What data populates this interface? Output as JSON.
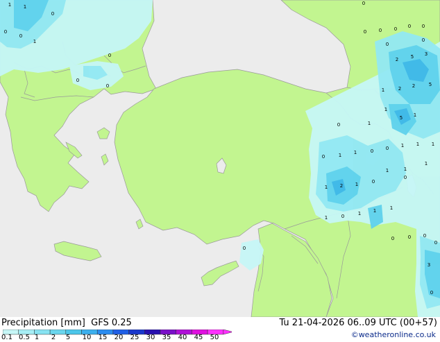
{
  "colors": {
    "sea": "#ececec",
    "land": "#c2f590",
    "border": "#999999",
    "p_light": "#c6f7f7",
    "p_mid": "#92e8f2",
    "p_strong": "#5fd2ec",
    "p_heavy": "#3fb8e8",
    "label": "#000000"
  },
  "legend": {
    "title": "Precipitation [mm]",
    "model": "GFS 0.25",
    "run_info": "Tu 21-04-2026 06..09 UTC (00+57)",
    "credit": "©weatheronline.co.uk",
    "scale_labels": [
      "0.1",
      "0.5",
      "1",
      "2",
      "5",
      "10",
      "15",
      "20",
      "25",
      "30",
      "35",
      "40",
      "45",
      "50"
    ],
    "scale_colors": [
      "#c6f7f7",
      "#a7eef5",
      "#88e3f2",
      "#6ad6ee",
      "#4cc6ea",
      "#3cb0ee",
      "#2b8cf0",
      "#1f5fe6",
      "#1a38cc",
      "#2810b0",
      "#7a10c8",
      "#b010d8",
      "#e010e0",
      "#ff30ff"
    ]
  },
  "map_labels": [
    "1",
    "1",
    "0",
    "0",
    "0",
    "1",
    "0",
    "0",
    "0",
    "0",
    "0",
    "0",
    "0",
    "0",
    "0",
    "0",
    "0",
    "2",
    "5",
    "3",
    "1",
    "2",
    "2",
    "5",
    "1",
    "5",
    "1",
    "0",
    "1",
    "0",
    "1",
    "1",
    "1",
    "0",
    "1",
    "1",
    "0",
    "1",
    "1",
    "1",
    "0",
    "1",
    "2",
    "1",
    "0",
    "1",
    "0",
    "1",
    "1",
    "1",
    "0",
    "0",
    "0",
    "0",
    "0",
    "3",
    "0"
  ]
}
